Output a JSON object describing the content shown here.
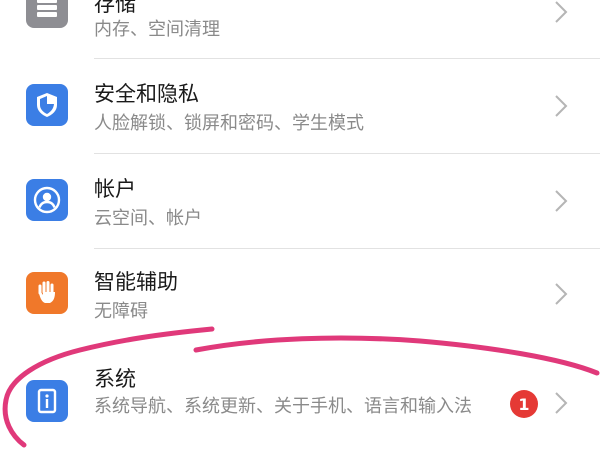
{
  "settings": {
    "items": [
      {
        "title": "存储",
        "subtitle": "内存、空间清理",
        "icon": "storage-icon",
        "icon_color": "#8e8e93"
      },
      {
        "title": "安全和隐私",
        "subtitle": "人脸解锁、锁屏和密码、学生模式",
        "icon": "shield-icon",
        "icon_color": "#3b7ee5"
      },
      {
        "title": "帐户",
        "subtitle": "云空间、帐户",
        "icon": "account-icon",
        "icon_color": "#3b7ee5"
      },
      {
        "title": "智能辅助",
        "subtitle": "无障碍",
        "icon": "hand-icon",
        "icon_color": "#f0782a"
      },
      {
        "title": "系统",
        "subtitle": "系统导航、系统更新、关于手机、语言和输入法",
        "icon": "info-icon",
        "icon_color": "#3b7ee5",
        "badge": "1"
      }
    ]
  },
  "colors": {
    "badge": "#e53935",
    "annotation_stroke": "#e0397a",
    "chevron": "#b5b5b5"
  }
}
